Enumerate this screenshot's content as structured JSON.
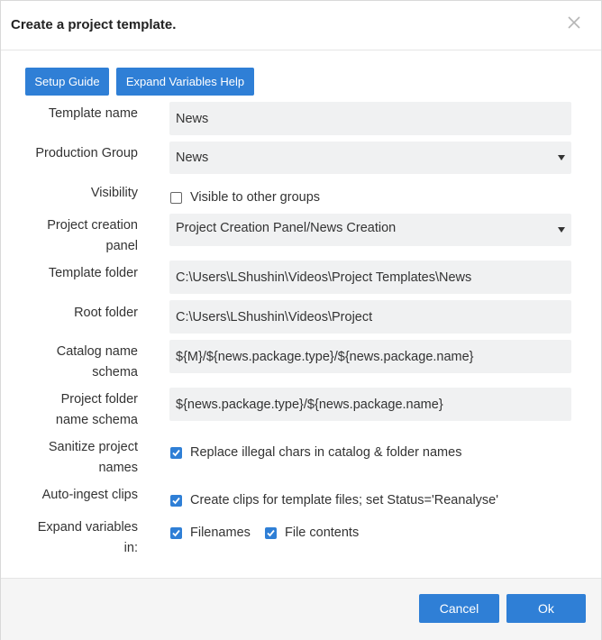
{
  "dialog": {
    "title": "Create a project template.",
    "close_icon": "close-icon"
  },
  "toolbar": {
    "setup_guide_label": "Setup Guide",
    "expand_help_label": "Expand Variables Help"
  },
  "form": {
    "template_name": {
      "label": "Template name",
      "value": "News"
    },
    "production_group": {
      "label": "Production Group",
      "value": "News"
    },
    "visibility": {
      "label": "Visibility",
      "checkbox_label": "Visible to other groups",
      "checked": false
    },
    "project_creation_panel": {
      "label_line1": "Project creation",
      "label_line2": "panel",
      "value": "Project Creation Panel/News Creation"
    },
    "template_folder": {
      "label": "Template folder",
      "value": "C:\\Users\\LShushin\\Videos\\Project Templates\\News"
    },
    "root_folder": {
      "label": "Root folder",
      "value": "C:\\Users\\LShushin\\Videos\\Project"
    },
    "catalog_name_schema": {
      "label_line1": "Catalog name",
      "label_line2": "schema",
      "value": "${M}/${news.package.type}/${news.package.name}"
    },
    "project_folder_schema": {
      "label_line1": "Project folder",
      "label_line2": "name schema",
      "value": "${news.package.type}/${news.package.name}"
    },
    "sanitize": {
      "label_line1": "Sanitize project",
      "label_line2": "names",
      "checkbox_label": "Replace illegal chars in catalog & folder names",
      "checked": true
    },
    "auto_ingest": {
      "label": "Auto-ingest clips",
      "checkbox_label": "Create clips for template files; set Status='Reanalyse'",
      "checked": true
    },
    "expand_variables": {
      "label_line1": "Expand variables",
      "label_line2": "in:",
      "filenames_label": "Filenames",
      "filenames_checked": true,
      "contents_label": "File contents",
      "contents_checked": true
    }
  },
  "footer": {
    "cancel_label": "Cancel",
    "ok_label": "Ok"
  },
  "colors": {
    "accent": "#2f7fd6",
    "field_bg": "#f0f1f2"
  }
}
